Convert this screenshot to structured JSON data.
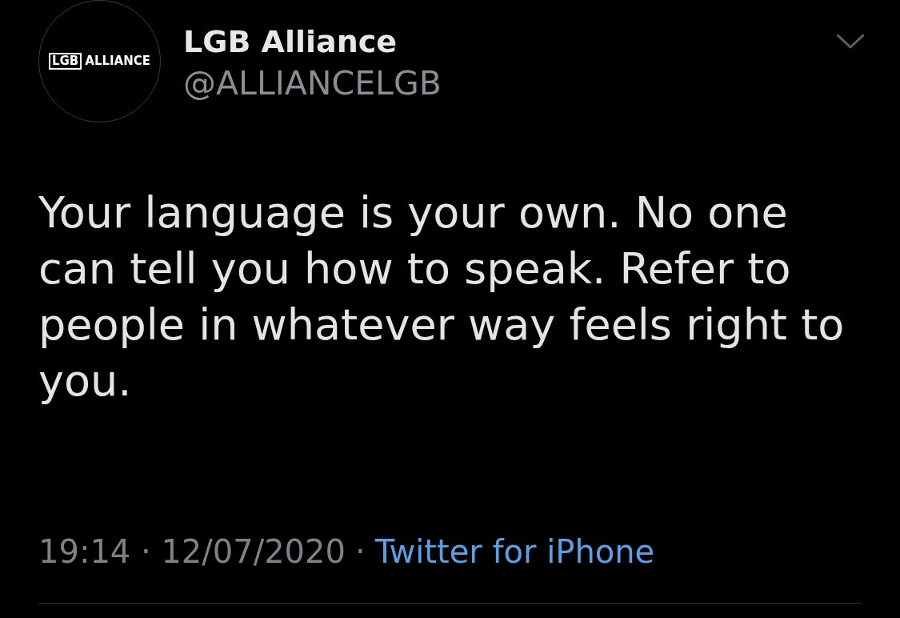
{
  "header": {
    "avatar": {
      "logo_boxed": "LGB",
      "logo_word": "ALLIANCE"
    },
    "name": "LGB Alliance",
    "handle": "@ALLIANCELGB"
  },
  "tweet": {
    "text": "Your language is your own. No one can tell you how to speak. Refer to people in whatever way feels right to you."
  },
  "footer": {
    "timestamp": "19:14 · 12/07/2020",
    "separator": "·",
    "source": "Twitter for iPhone"
  }
}
